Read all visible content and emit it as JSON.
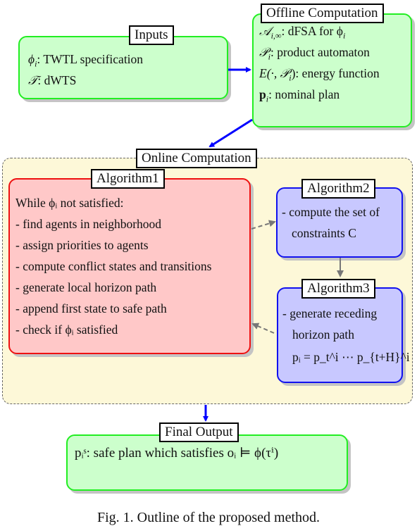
{
  "inputs": {
    "title": "Inputs",
    "lines": [
      {
        "sym": "ϕ",
        "sub": "i",
        "text": ": TWTL specification"
      },
      {
        "sym": "𝒯",
        "sub": "",
        "text": ": dWTS"
      }
    ]
  },
  "offline": {
    "title": "Offline Computation",
    "lines": [
      {
        "sym": "𝒜",
        "sub": "i,∞",
        "text": ": dFSA for ϕ",
        "tail_sub": "i"
      },
      {
        "sym": "𝒫",
        "sub": "i",
        "text": ": product automaton"
      },
      {
        "sym": "E(·, 𝒫",
        "sub": "i",
        "text": "): energy function"
      },
      {
        "sym": "p",
        "sub": "i",
        "text": ": nominal plan"
      }
    ]
  },
  "online": {
    "title": "Online Computation"
  },
  "algorithm1": {
    "title": "Algorithm1",
    "lines": [
      "While ϕᵢ not satisfied:",
      "- find agents in neighborhood",
      "- assign priorities to agents",
      "- compute conflict states and transitions",
      "- generate local horizon path",
      "- append first state to safe path",
      "- check if ϕᵢ satisfied"
    ]
  },
  "algorithm2": {
    "title": "Algorithm2",
    "lines": [
      "- compute the set of",
      "constraints C"
    ]
  },
  "algorithm3": {
    "title": "Algorithm3",
    "lines": [
      "- generate receding",
      "horizon path",
      "pᵢ = p_t^i ⋯ p_{t+H}^i"
    ]
  },
  "final": {
    "title": "Final Output",
    "line": "pᵢˢ: safe plan which satisfies oᵢ ⊨ ϕ(τⁱ)"
  },
  "caption": "Fig. 1.   Outline of the proposed method.",
  "colors": {
    "green_fill": "#ccffcc",
    "green_border": "#22ee22",
    "red_fill": "#ffc8c8",
    "red_border": "#ee1111",
    "blue_fill": "#c8c8ff",
    "blue_border": "#1111ee",
    "online_fill": "#fdf8d8",
    "arrow_blue": "#0000ff",
    "arrow_gray": "#777777"
  }
}
